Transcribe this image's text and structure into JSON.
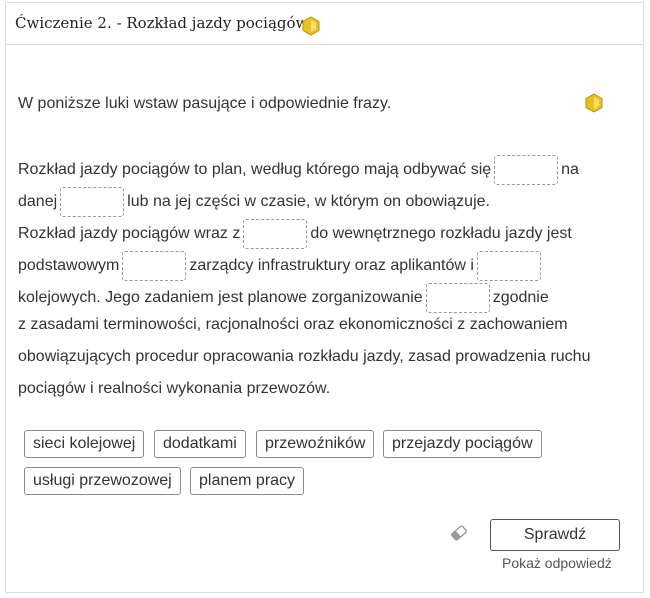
{
  "exercise": {
    "title": "Ćwiczenie 2. - Rozkład jazdy pociągów",
    "instruction": "W poniższe luki wstaw pasujące i odpowiednie frazy."
  },
  "text": {
    "l1a": "Rozkład jazdy pociągów to plan, według którego mają odbywać się",
    "l1b": "na",
    "l2a": "danej",
    "l2b": "lub na jej części w czasie, w którym on obowiązuje.",
    "l3a": "Rozkład jazdy pociągów wraz z",
    "l3b": "do wewnętrznego rozkładu jazdy jest",
    "l4a": "podstawowym",
    "l4b": "zarządcy infrastruktury oraz aplikantów i",
    "l5a": "kolejowych. Jego zadaniem jest planowe zorganizowanie",
    "l5b": "zgodnie",
    "l6": "z zasadami terminowości, racjonalności oraz ekonomiczności z zachowaniem",
    "l7": "obowiązujących procedur opracowania rozkładu jazdy, zasad prowadzenia ruchu",
    "l8": "pociągów i realności wykonania przewozów."
  },
  "options": [
    "sieci kolejowej",
    "dodatkami",
    "przewoźników",
    "przejazdy pociągów",
    "usługi przewozowej",
    "planem pracy"
  ],
  "actions": {
    "check_label": "Sprawdź",
    "show_answer_label": "Pokaż odpowiedź"
  },
  "icons": {
    "hex": "hexagon-icon",
    "eraser": "eraser-icon",
    "hex_color": "#e8c21a"
  }
}
